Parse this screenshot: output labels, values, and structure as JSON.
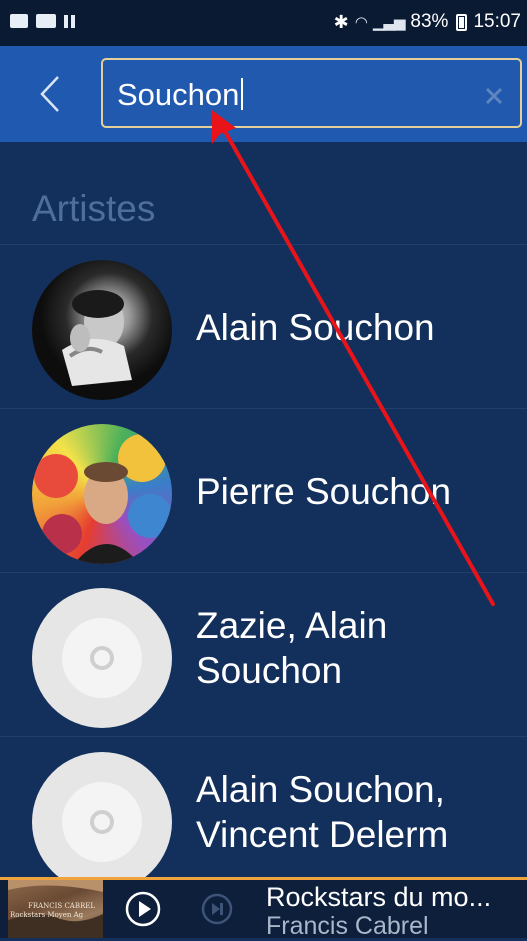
{
  "status_bar": {
    "battery_text": "83%",
    "time": "15:07",
    "battery_level": 0.83
  },
  "search": {
    "query": "Souchon"
  },
  "results": {
    "section_title": "Artistes",
    "artists": [
      {
        "name": "Alain Souchon",
        "avatar": "bw-portrait-photo"
      },
      {
        "name": "Pierre Souchon",
        "avatar": "balloons-portrait-photo"
      },
      {
        "name_line1": "Zazie, Alain",
        "name_line2": "Souchon",
        "avatar": "default-disc-icon"
      },
      {
        "name_line1": "Alain Souchon,",
        "name_line2": "Vincent Delerm",
        "avatar": "default-disc-icon"
      }
    ]
  },
  "player": {
    "track_title": "Rockstars du mo...",
    "track_artist": "Francis Cabrel",
    "album_art_text_1": "FRANCIS CABREL",
    "album_art_text_2": "Rockstars Moyen Ag"
  },
  "colors": {
    "header": "#2059b0",
    "background": "#13305c",
    "search_border": "#e4cf9a",
    "player_accent": "#f0a23d",
    "annotation_arrow": "#e8141a"
  }
}
